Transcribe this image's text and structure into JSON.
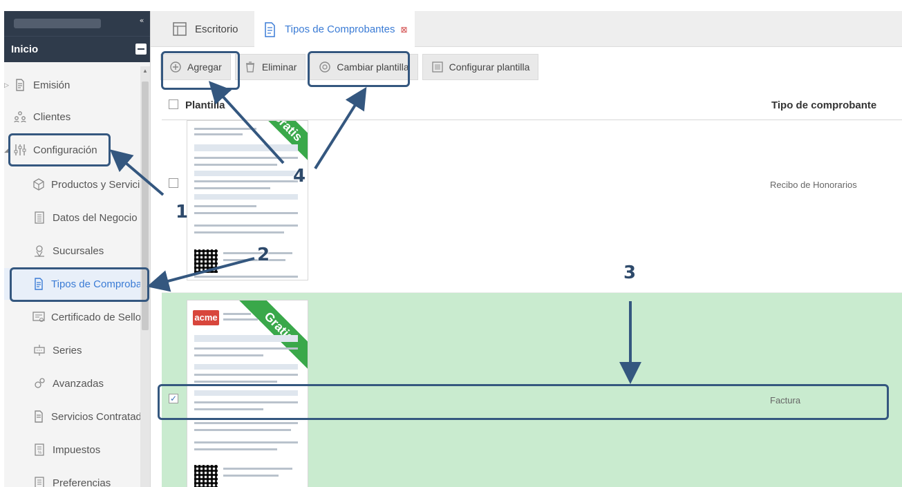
{
  "sidebar": {
    "inicio_label": "Inicio",
    "collapse_glyph": "«",
    "items": [
      {
        "label": "Emisión",
        "icon": "document-icon"
      },
      {
        "label": "Clientes",
        "icon": "users-icon"
      },
      {
        "label": "Configuración",
        "icon": "sliders-icon"
      },
      {
        "label": "Productos y Servicios",
        "icon": "box-icon"
      },
      {
        "label": "Datos del Negocio",
        "icon": "building-icon"
      },
      {
        "label": "Sucursales",
        "icon": "location-icon"
      },
      {
        "label": "Tipos de Comproban",
        "icon": "document-icon"
      },
      {
        "label": "Certificado de Sello D",
        "icon": "certificate-icon"
      },
      {
        "label": "Series",
        "icon": "series-icon"
      },
      {
        "label": "Avanzadas",
        "icon": "gear-icon"
      },
      {
        "label": "Servicios Contratados",
        "icon": "document-icon"
      },
      {
        "label": "Impuestos",
        "icon": "tax-icon"
      },
      {
        "label": "Preferencias",
        "icon": "preferences-icon"
      }
    ]
  },
  "tabs": [
    {
      "label": "Escritorio",
      "icon": "desktop-icon"
    },
    {
      "label": "Tipos de Comprobantes",
      "icon": "document-icon",
      "close_glyph": "⊠"
    }
  ],
  "toolbar": {
    "agregar": "Agregar",
    "eliminar": "Eliminar",
    "cambiar": "Cambiar plantilla",
    "configurar": "Configurar plantilla"
  },
  "grid": {
    "header_plantilla": "Plantilla",
    "header_tipo": "Tipo de comprobante",
    "rows": [
      {
        "tipo": "Recibo de Honorarios",
        "checked": false,
        "ribbon": "Gratis"
      },
      {
        "tipo": "Factura",
        "checked": true,
        "ribbon": "Gratis",
        "logo": "acme"
      }
    ]
  },
  "annotations": {
    "n1": "1",
    "n2": "2",
    "n3": "3",
    "n4": "4"
  },
  "colors": {
    "sidebar_dark": "#2f3b4b",
    "accent": "#3a7bd5",
    "annotation": "#34577f",
    "selected_row": "#c9ebcf",
    "ribbon": "#3aa84a"
  }
}
